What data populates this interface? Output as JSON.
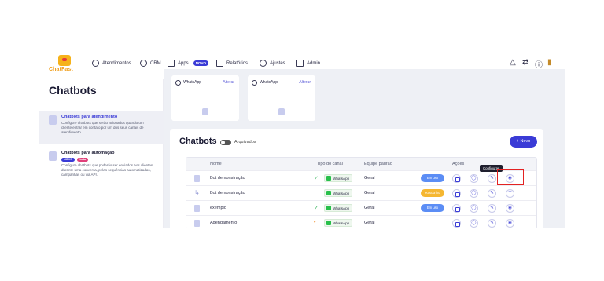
{
  "header": {
    "logo_text": "ChatFast",
    "nav": [
      {
        "label": "Atendimentos",
        "icon": "chat-icon"
      },
      {
        "label": "CRM",
        "icon": "crm-icon"
      },
      {
        "label": "Apps",
        "icon": "grid-icon",
        "badge": "NOVO"
      },
      {
        "label": "Relatórios",
        "icon": "report-icon"
      },
      {
        "label": "Ajustes",
        "icon": "gear-icon"
      },
      {
        "label": "Admin",
        "icon": "admin-icon"
      }
    ],
    "right_icons": [
      "bell-icon",
      "share-icon",
      "help-icon",
      "books-icon"
    ]
  },
  "sidebar": {
    "title": "Chatbots",
    "items": [
      {
        "title": "Chatbots para atendimento",
        "desc": "Configure chatbots que serão acionados quando um cliente entrar em contato por um dos seus canais de atendimento."
      },
      {
        "title": "Chatbots para automação",
        "tags": [
          "NOVO",
          "beta"
        ],
        "desc": "Configure chatbots que poderão ser enviados aos clientes durante uma conversa, pelas sequências automatizadas, campanhas ou via API."
      }
    ]
  },
  "channels": [
    {
      "name": "WhatsApp",
      "action": "Alterar"
    },
    {
      "name": "WhatsApp",
      "action": "Alterar"
    }
  ],
  "panel": {
    "title": "Chatbots",
    "toggle_label": "Arquivados",
    "new_button": "+ Novo",
    "columns": [
      "Nome",
      "Tipo do canal",
      "Equipe padrão",
      "Ações"
    ],
    "tooltip": "Configurar",
    "rows": [
      {
        "name": "Bot demonstração",
        "status_icon": "✓",
        "channel": "WhatsApp",
        "team": "Geral",
        "pill": "Em uso",
        "pill_color": "#5b8df5"
      },
      {
        "name": "Bot demonstração",
        "status_icon": "",
        "channel": "WhatsApp",
        "team": "Geral",
        "pill": "Rascunho",
        "pill_color": "#f5b731"
      },
      {
        "name": "exemplo",
        "status_icon": "✓",
        "channel": "WhatsApp",
        "team": "Geral",
        "pill": "Em uso",
        "pill_color": "#5b8df5"
      },
      {
        "name": "Agendamento",
        "status_icon": "•",
        "channel": "WhatsApp",
        "team": "Geral",
        "pill": "",
        "pill_color": ""
      }
    ]
  },
  "colors": {
    "accent": "#3a3bd6",
    "highlight": "#e32222"
  }
}
